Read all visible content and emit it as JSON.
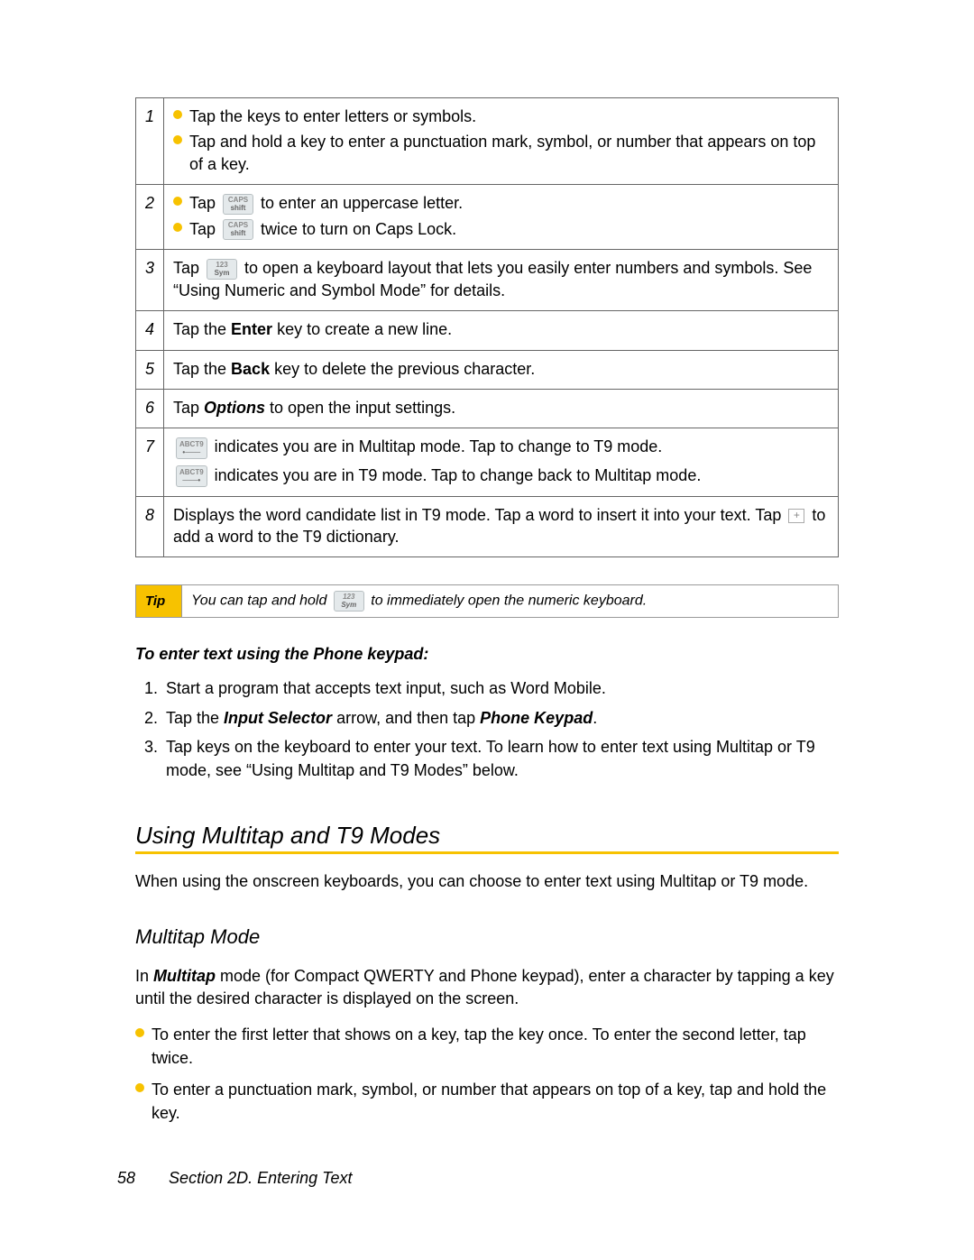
{
  "table": {
    "rows": [
      {
        "n": "1",
        "lines": [
          "Tap the keys to enter letters or symbols.",
          "Tap and hold a key to enter a punctuation mark, symbol, or number that appears on top of a key."
        ],
        "bullets": true
      },
      {
        "n": "2",
        "lines": [
          {
            "pre": "Tap ",
            "key": {
              "top": "CAPS",
              "bot": "shift"
            },
            "post": " to enter an uppercase letter."
          },
          {
            "pre": "Tap ",
            "key": {
              "top": "CAPS",
              "bot": "shift"
            },
            "post": " twice to turn on Caps Lock."
          }
        ],
        "bullets": true
      },
      {
        "n": "3",
        "text_pre": "Tap ",
        "key": {
          "top": "123",
          "bot": "Sym"
        },
        "text_post": " to open a keyboard layout that lets you easily enter numbers and symbols. See “Using Numeric and Symbol Mode” for details."
      },
      {
        "n": "4",
        "plain_pre": "Tap the ",
        "bold": "Enter",
        "plain_post": " key to create a new line."
      },
      {
        "n": "5",
        "plain_pre": "Tap the ",
        "bold": "Back",
        "plain_post": " key to delete the previous character."
      },
      {
        "n": "6",
        "plain_pre": "Tap ",
        "bi": "Options",
        "plain_post": " to open the input settings."
      },
      {
        "n": "7",
        "mode_lines": [
          {
            "key": "ABCT9",
            "text": " indicates you are in Multitap mode. Tap to change to T9 mode."
          },
          {
            "key": "ABCT9",
            "text": " indicates you are in T9 mode. Tap to change back to Multitap mode."
          }
        ]
      },
      {
        "n": "8",
        "t8_pre": "Displays the word candidate list in T9 mode. Tap a word to insert it into your text. Tap ",
        "t8_post": " to add a word to the T9 dictionary."
      }
    ]
  },
  "tip": {
    "label": "Tip",
    "pre": "You can tap and hold ",
    "key": {
      "top": "123",
      "bot": "Sym"
    },
    "post": " to immediately open the numeric keyboard."
  },
  "subheading1": "To enter text using the Phone keypad:",
  "steps": [
    "Start a program that accepts text input, such as Word Mobile.",
    {
      "pre": "Tap the ",
      "bi1": "Input Selector",
      "mid": " arrow, and then tap ",
      "bi2": "Phone Keypad",
      "post": "."
    },
    "Tap keys on the keyboard to enter your text. To learn how to enter text using Multitap or T9 mode, see “Using Multitap and T9 Modes” below."
  ],
  "h2": "Using Multitap and T9 Modes",
  "h2_para": "When using the onscreen keyboards, you can choose to enter text using Multitap or T9 mode.",
  "h3": "Multitap Mode",
  "h3_para_pre": "In ",
  "h3_para_bi": "Multitap",
  "h3_para_post": " mode (for Compact QWERTY and Phone keypad), enter a character by tapping a key until the desired character is displayed on the screen.",
  "ybul": [
    "To enter the first letter that shows on a key, tap the key once. To enter the second letter, tap twice.",
    "To enter a punctuation mark, symbol, or number that appears on top of a key, tap and hold the key."
  ],
  "footer": {
    "page": "58",
    "section": "Section 2D. Entering Text"
  }
}
